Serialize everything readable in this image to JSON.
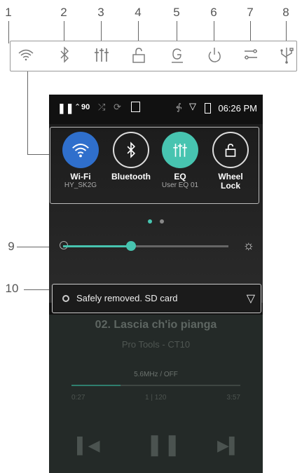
{
  "callouts": {
    "top": [
      "1",
      "2",
      "3",
      "4",
      "5",
      "6",
      "7",
      "8"
    ],
    "side": [
      "9",
      "10"
    ]
  },
  "top_icons": [
    "wifi-icon",
    "bluetooth-icon",
    "eq-icon",
    "wheel-lock-icon",
    "gain-icon",
    "power-icon",
    "settings-icon",
    "usb-icon"
  ],
  "status_bar": {
    "volume": "90",
    "time": "06:26 PM"
  },
  "quick_settings": [
    {
      "label": "Wi-Fi",
      "sub": "HY_SK2G",
      "color": "#2f6fcc",
      "active": true
    },
    {
      "label": "Bluetooth",
      "sub": "",
      "color": "#111111",
      "active": false
    },
    {
      "label": "EQ",
      "sub": "User EQ 01",
      "color": "#47c4b0",
      "active": true
    },
    {
      "label": "Wheel\nLock",
      "sub": "",
      "color": "#111111",
      "active": false
    }
  ],
  "pager": {
    "total": 2,
    "current": 1
  },
  "brightness": {
    "level": 0.41
  },
  "notification": {
    "text": "Safely removed. SD card"
  },
  "player": {
    "title": "02. Lascia ch'io pianga",
    "artist": "Pro Tools - CT10",
    "format": "5.6MHz / OFF",
    "elapsed": "0:27",
    "track": "1 | 120",
    "total": "3:57",
    "progress": 0.29
  },
  "colors": {
    "accent": "#47c4b0",
    "wifi_blue": "#2f6fcc"
  }
}
